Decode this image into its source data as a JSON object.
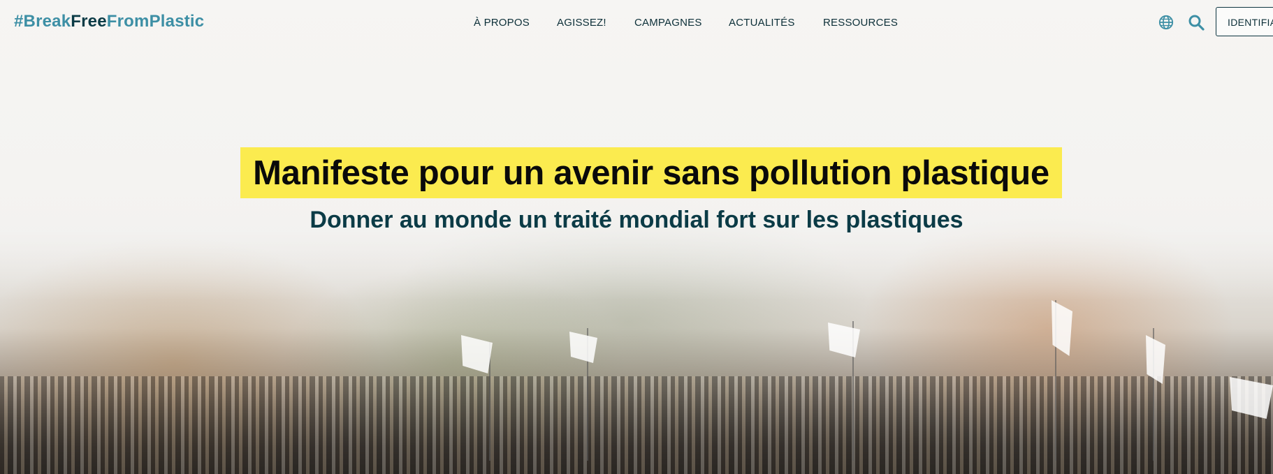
{
  "header": {
    "logo": {
      "part1": "#Break",
      "part2": "Free",
      "part3": "FromPlastic"
    },
    "nav": [
      {
        "label": "À PROPOS"
      },
      {
        "label": "AGISSEZ!"
      },
      {
        "label": "CAMPAGNES"
      },
      {
        "label": "ACTUALITÉS"
      },
      {
        "label": "RESSOURCES"
      }
    ],
    "icons": {
      "language": "globe-icon",
      "search": "search-icon"
    },
    "login_label": "IDENTIFIANT"
  },
  "hero": {
    "title": "Manifeste pour un avenir sans pollution plastique",
    "subtitle": "Donner au monde un traité mondial fort sur les plastiques"
  },
  "colors": {
    "brand_teal": "#3d8fa5",
    "brand_dark": "#0b3b46",
    "highlight_yellow": "#fbeb4f"
  }
}
